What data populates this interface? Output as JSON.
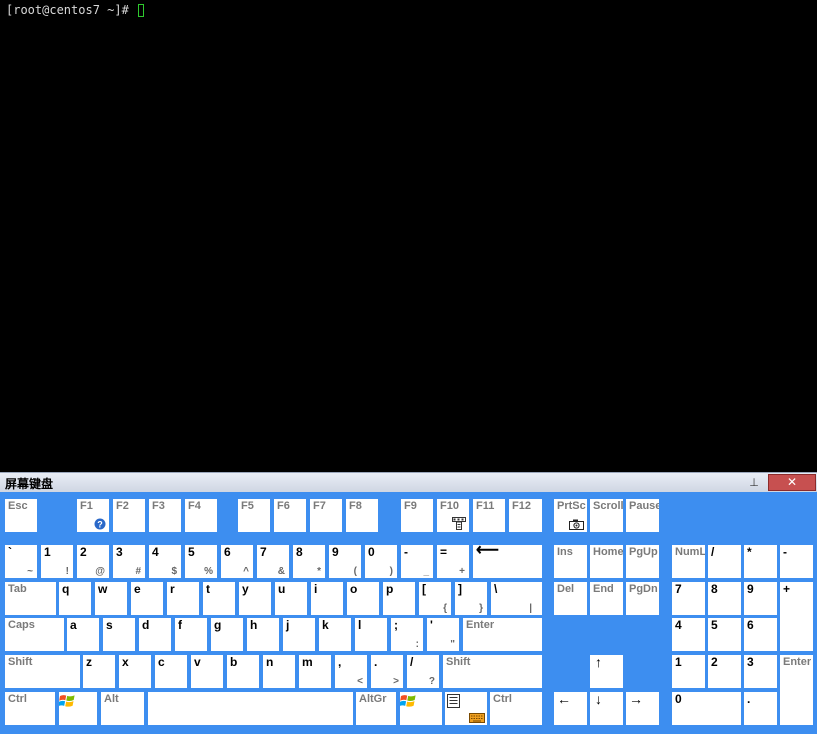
{
  "terminal": {
    "prompt": "[root@centos7 ~]# "
  },
  "osk": {
    "title": "屏幕键盘",
    "pin_glyph": "⊥",
    "close_glyph": "✕",
    "icons": {
      "help": "help-icon",
      "options": "options-icon",
      "camera": "camera-icon",
      "windows": "windows-logo-icon",
      "menu": "menu-icon"
    },
    "fn_row": {
      "esc": "Esc",
      "f1": "F1",
      "f2": "F2",
      "f3": "F3",
      "f4": "F4",
      "f5": "F5",
      "f6": "F6",
      "f7": "F7",
      "f8": "F8",
      "f9": "F9",
      "f10": "F10",
      "f11": "F11",
      "f12": "F12",
      "prtsc": "PrtSc",
      "scroll": "Scroll",
      "pause": "Pause"
    },
    "number_row": {
      "backtick": "`",
      "backtick_shift": "~",
      "k1": "1",
      "k1_shift": "!",
      "k2": "2",
      "k2_shift": "@",
      "k3": "3",
      "k3_shift": "#",
      "k4": "4",
      "k4_shift": "$",
      "k5": "5",
      "k5_shift": "%",
      "k6": "6",
      "k6_shift": "^",
      "k7": "7",
      "k7_shift": "&",
      "k8": "8",
      "k8_shift": "*",
      "k9": "9",
      "k9_shift": "(",
      "k0": "0",
      "k0_shift": ")",
      "minus": "-",
      "minus_shift": "_",
      "equals": "=",
      "equals_shift": "+",
      "backspace": "⟵"
    },
    "qwerty_row": {
      "tab": "Tab",
      "q": "q",
      "w": "w",
      "e": "e",
      "r": "r",
      "t": "t",
      "y": "y",
      "u": "u",
      "i": "i",
      "o": "o",
      "p": "p",
      "lbracket": "[",
      "lbracket_shift": "{",
      "rbracket": "]",
      "rbracket_shift": "}",
      "backslash": "\\",
      "backslash_shift": "|"
    },
    "home_row": {
      "caps": "Caps",
      "a": "a",
      "s": "s",
      "d": "d",
      "f": "f",
      "g": "g",
      "h": "h",
      "j": "j",
      "k": "k",
      "l": "l",
      "semicolon": ";",
      "semicolon_shift": ":",
      "quote": "'",
      "quote_shift": "\"",
      "enter": "Enter"
    },
    "shift_row": {
      "lshift": "Shift",
      "z": "z",
      "x": "x",
      "c": "c",
      "v": "v",
      "b": "b",
      "n": "n",
      "m": "m",
      "comma": ",",
      "comma_shift": "<",
      "period": ".",
      "period_shift": ">",
      "slash": "/",
      "slash_shift": "?",
      "rshift": "Shift"
    },
    "bottom_row": {
      "lctrl": "Ctrl",
      "alt": "Alt",
      "space": "",
      "altgr": "AltGr",
      "rctrl": "Ctrl"
    },
    "nav": {
      "ins": "Ins",
      "home": "Home",
      "pgup": "PgUp",
      "del": "Del",
      "end": "End",
      "pgdn": "PgDn",
      "up": "↑",
      "left": "←",
      "down": "↓",
      "right": "→"
    },
    "numpad": {
      "numlock": "NumL",
      "divide": "/",
      "multiply": "*",
      "minus": "-",
      "n7": "7",
      "n8": "8",
      "n9": "9",
      "plus": "+",
      "n4": "4",
      "n5": "5",
      "n6": "6",
      "n1": "1",
      "n2": "2",
      "n3": "3",
      "enter": "Enter",
      "n0": "0",
      "decimal": "."
    }
  }
}
